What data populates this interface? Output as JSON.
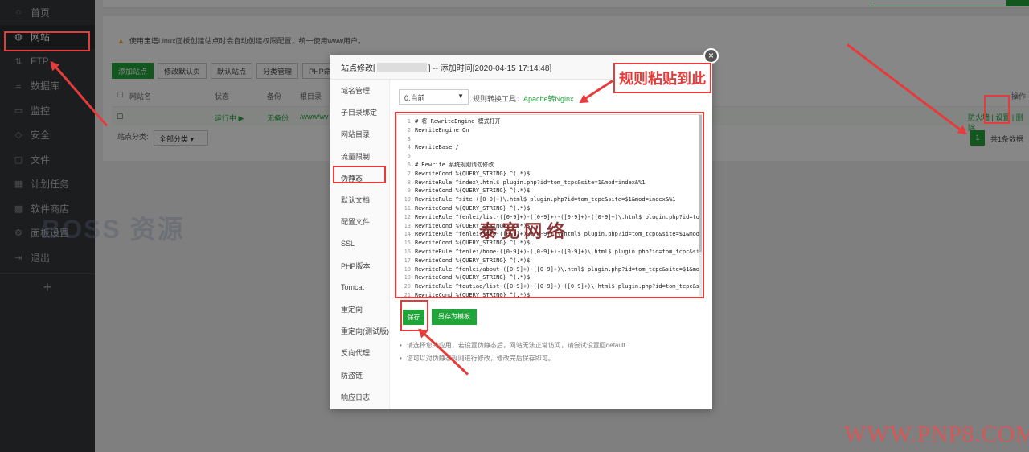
{
  "sidebar": {
    "items": [
      {
        "label": "首页",
        "icon": "home-icon"
      },
      {
        "label": "网站",
        "icon": "globe-icon",
        "active": true
      },
      {
        "label": "FTP",
        "icon": "ftp-icon"
      },
      {
        "label": "数据库",
        "icon": "database-icon"
      },
      {
        "label": "监控",
        "icon": "monitor-icon"
      },
      {
        "label": "安全",
        "icon": "shield-icon"
      },
      {
        "label": "文件",
        "icon": "folder-icon"
      },
      {
        "label": "计划任务",
        "icon": "calendar-icon"
      },
      {
        "label": "软件商店",
        "icon": "grid-icon"
      },
      {
        "label": "面板设置",
        "icon": "gear-icon"
      },
      {
        "label": "退出",
        "icon": "logout-icon"
      }
    ],
    "add": "+"
  },
  "page": {
    "warning": "使用宝塔Linux面板创建站点时会自动创建权限配置，统一使用www用户。",
    "buttons": [
      "添加站点",
      "修改默认页",
      "默认站点",
      "分类管理",
      "PHP命令行版本"
    ],
    "table_headers": [
      "网站名",
      "状态",
      "备份",
      "根目录",
      "操作"
    ],
    "row": {
      "status": "运行中 ▶",
      "backup": "无备份",
      "root": "/www/wv",
      "ops": "防火墙 | 设置 | 删除"
    },
    "category_label": "站点分类:",
    "category_value": "全部分类",
    "pager_num": "1",
    "pager_total": "共1条数据"
  },
  "modal": {
    "title_prefix": "站点修改[",
    "title_suffix": "] -- 添加时间[2020-04-15 17:14:48]",
    "close": "×",
    "menu": [
      "域名管理",
      "子目录绑定",
      "网站目录",
      "流量限制",
      "伪静态",
      "默认文档",
      "配置文件",
      "SSL",
      "PHP版本",
      "Tomcat",
      "重定向",
      "重定向(测试版)",
      "反向代理",
      "防盗链",
      "响应日志"
    ],
    "select_value": "0.当前",
    "rule_tool_label": "规则转换工具：",
    "rule_tool_link": "Apache转Nginx",
    "code_lines": [
      "# 将 RewriteEngine 模式打开",
      "RewriteEngine On",
      "",
      "RewriteBase /",
      "",
      "# Rewrite 系统规则请勿修改",
      "RewriteCond %{QUERY_STRING} ^(.*)$",
      "RewriteRule ^index\\.html$ plugin.php?id=tom_tcpc&site=1&mod=index&%1",
      "RewriteCond %{QUERY_STRING} ^(.*)$",
      "RewriteRule ^site-([0-9]+)\\.html$ plugin.php?id=tom_tcpc&site=$1&mod=index&%1",
      "RewriteCond %{QUERY_STRING} ^(.*)$",
      "RewriteRule ^fenlei/list-([0-9]+)-([0-9]+)-([0-9]+)-([0-9]+)\\.html$ plugin.php?id=tom_",
      "RewriteCond %{QUERY_STRING} ^(.*)$",
      "RewriteRule ^fenlei/info-([0-9]+)-([0-9]+)\\.html$ plugin.php?id=tom_tcpc&site=$1&mod=",
      "RewriteCond %{QUERY_STRING} ^(.*)$",
      "RewriteRule ^fenlei/home-([0-9]+)-([0-9]+)-([0-9]+)\\.html$ plugin.php?id=tom_tcpc&sit",
      "RewriteCond %{QUERY_STRING} ^(.*)$",
      "RewriteRule ^fenlei/about-([0-9]+)-([0-9]+)\\.html$ plugin.php?id=tom_tcpc&site=$1&mod",
      "RewriteCond %{QUERY_STRING} ^(.*)$",
      "RewriteRule ^toutiao/list-([0-9]+)-([0-9]+)-([0-9]+)\\.html$ plugin.php?id=tom_tcpc&si",
      "RewriteCond %{QUERY_STRING} ^(.*)$"
    ],
    "save": "保存",
    "save_template": "另存为模板",
    "tips": [
      "请选择您的应用，若设置伪静态后，网站无法正常访问，请尝试设置回default",
      "您可以对伪静态规则进行修改，修改完后保存即可。"
    ]
  },
  "annotation": {
    "callout": "规则粘贴到此"
  },
  "watermarks": {
    "boss": "BOSS 资源",
    "cn": "泰 宽 网 络",
    "url": "WWW.PNP8.COM"
  },
  "colors": {
    "accent": "#20a53a",
    "annotation": "#e53b3b",
    "sidebar": "#35383c"
  }
}
